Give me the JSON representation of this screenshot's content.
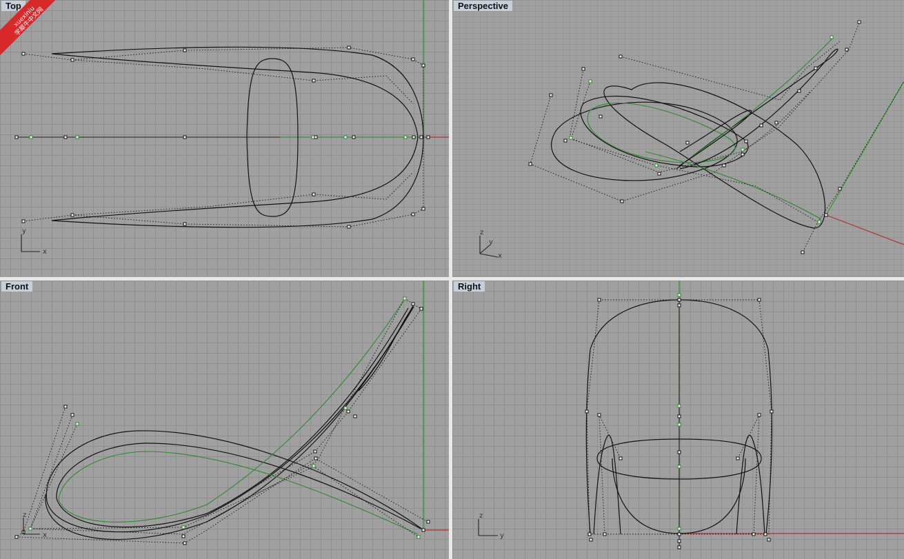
{
  "viewports": {
    "top": {
      "title": "Top"
    },
    "perspective": {
      "title": "Perspective"
    },
    "front": {
      "title": "Front"
    },
    "right": {
      "title": "Right"
    }
  },
  "axes_icons": {
    "top": {
      "v": "y",
      "h": "x"
    },
    "perspective": {
      "v": "z",
      "d": "y",
      "h": "x"
    },
    "front": {
      "v": "z",
      "h": "x"
    },
    "right": {
      "v": "z",
      "h": "y"
    }
  },
  "watermark": {
    "line1": "xuexiniu",
    "line2": "学犀牛中文网"
  },
  "colors": {
    "grid_bg": "#a0a0a0",
    "curve": "#111111",
    "selected_curve": "#2c8a2c",
    "x_axis": "#b03030",
    "y_axis": "#2a9a2a"
  }
}
